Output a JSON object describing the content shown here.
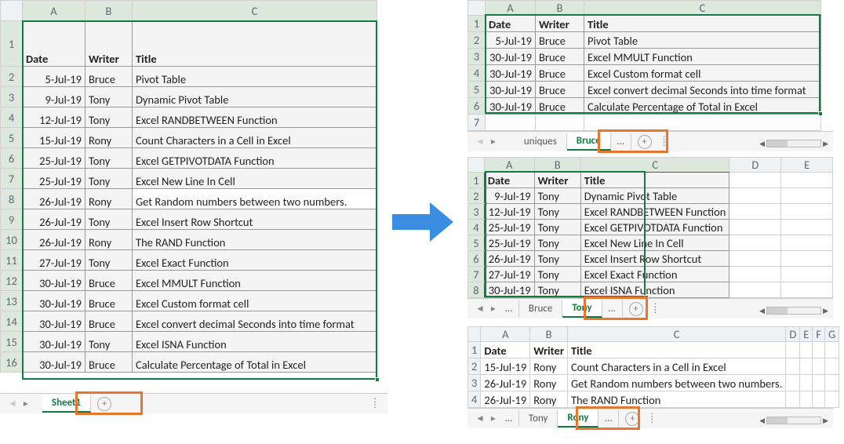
{
  "main": {
    "headers": {
      "A": "Date",
      "B": "Writer",
      "C": "Title"
    },
    "rows": [
      {
        "date": "5-Jul-19",
        "writer": "Bruce",
        "title": "Pivot Table"
      },
      {
        "date": "9-Jul-19",
        "writer": "Tony",
        "title": "Dynamic Pivot Table"
      },
      {
        "date": "12-Jul-19",
        "writer": "Tony",
        "title": "Excel RANDBETWEEN Function"
      },
      {
        "date": "15-Jul-19",
        "writer": "Rony",
        "title": "Count Characters in a Cell in Excel"
      },
      {
        "date": "25-Jul-19",
        "writer": "Tony",
        "title": "Excel GETPIVOTDATA Function"
      },
      {
        "date": "25-Jul-19",
        "writer": "Tony",
        "title": "Excel New Line In Cell"
      },
      {
        "date": "26-Jul-19",
        "writer": "Rony",
        "title": "Get Random numbers between two numbers."
      },
      {
        "date": "26-Jul-19",
        "writer": "Tony",
        "title": "Excel Insert Row Shortcut"
      },
      {
        "date": "26-Jul-19",
        "writer": "Rony",
        "title": "The RAND Function"
      },
      {
        "date": "27-Jul-19",
        "writer": "Tony",
        "title": "Excel Exact Function"
      },
      {
        "date": "30-Jul-19",
        "writer": "Bruce",
        "title": "Excel MMULT Function"
      },
      {
        "date": "30-Jul-19",
        "writer": "Bruce",
        "title": "Excel Custom format cell"
      },
      {
        "date": "30-Jul-19",
        "writer": "Bruce",
        "title": "Excel convert decimal Seconds into time format"
      },
      {
        "date": "30-Jul-19",
        "writer": "Tony",
        "title": "Excel ISNA Function"
      },
      {
        "date": "30-Jul-19",
        "writer": "Bruce",
        "title": "Calculate Percentage of Total in Excel"
      }
    ],
    "tabs": {
      "active": "Sheet1"
    }
  },
  "bruce": {
    "headers": {
      "A": "Date",
      "B": "Writer",
      "C": "Title"
    },
    "rows": [
      {
        "date": "5-Jul-19",
        "writer": "Bruce",
        "title": "Pivot Table"
      },
      {
        "date": "30-Jul-19",
        "writer": "Bruce",
        "title": "Excel MMULT Function"
      },
      {
        "date": "30-Jul-19",
        "writer": "Bruce",
        "title": "Excel Custom format cell"
      },
      {
        "date": "30-Jul-19",
        "writer": "Bruce",
        "title": "Excel convert decimal Seconds into time format"
      },
      {
        "date": "30-Jul-19",
        "writer": "Bruce",
        "title": "Calculate Percentage of Total in Excel"
      }
    ],
    "tabs": {
      "left": "uniques",
      "active": "Bruce",
      "ell": "…"
    }
  },
  "tony": {
    "headers": {
      "A": "Date",
      "B": "Writer",
      "C": "Title"
    },
    "rows": [
      {
        "date": "9-Jul-19",
        "writer": "Tony",
        "title": "Dynamic Pivot Table"
      },
      {
        "date": "12-Jul-19",
        "writer": "Tony",
        "title": "Excel RANDBETWEEN Function"
      },
      {
        "date": "25-Jul-19",
        "writer": "Tony",
        "title": "Excel GETPIVOTDATA Function"
      },
      {
        "date": "25-Jul-19",
        "writer": "Tony",
        "title": "Excel New Line In Cell"
      },
      {
        "date": "26-Jul-19",
        "writer": "Tony",
        "title": "Excel Insert Row Shortcut"
      },
      {
        "date": "27-Jul-19",
        "writer": "Tony",
        "title": "Excel Exact Function"
      },
      {
        "date": "30-Jul-19",
        "writer": "Tony",
        "title": "Excel ISNA Function"
      }
    ],
    "tabs": {
      "ell1": "…",
      "left": "Bruce",
      "active": "Tony",
      "ell2": "…"
    },
    "extra_cols": [
      "D",
      "E"
    ]
  },
  "rony": {
    "headers": {
      "A": "Date",
      "B": "Writer",
      "C": "Title"
    },
    "rows": [
      {
        "date": "15-Jul-19",
        "writer": "Rony",
        "title": "Count Characters in a Cell in Excel"
      },
      {
        "date": "26-Jul-19",
        "writer": "Rony",
        "title": "Get Random numbers between two numbers."
      },
      {
        "date": "26-Jul-19",
        "writer": "Rony",
        "title": "The RAND Function"
      }
    ],
    "tabs": {
      "ell1": "…",
      "left": "Tony",
      "active": "Rony",
      "ell2": "…"
    },
    "extra_cols": [
      "D",
      "E",
      "F",
      "G"
    ]
  },
  "col_letters": [
    "A",
    "B",
    "C",
    "D",
    "E",
    "F",
    "G"
  ],
  "row_nums": [
    "1",
    "2",
    "3",
    "4",
    "5",
    "6",
    "7",
    "8",
    "9",
    "10",
    "11",
    "12",
    "13",
    "14",
    "15",
    "16"
  ],
  "newtab": "+"
}
